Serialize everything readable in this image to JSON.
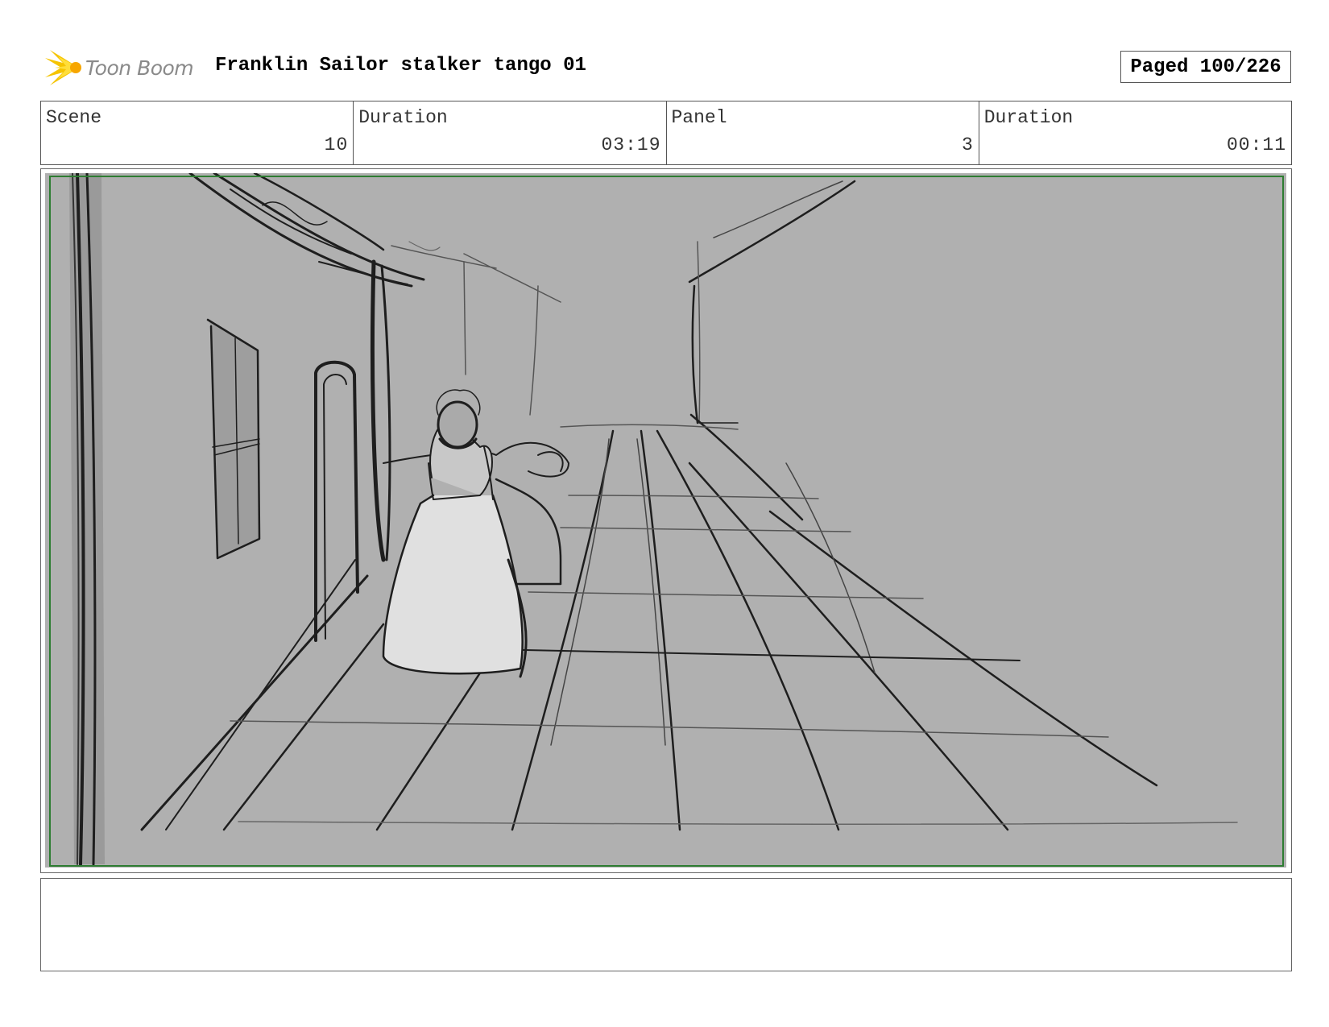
{
  "header": {
    "logo_text": "Toon Boom",
    "title": "Franklin Sailor stalker tango 01",
    "paged": "Paged 100/226"
  },
  "info": {
    "scene_label": "Scene",
    "scene_value": "10",
    "scene_duration_label": "Duration",
    "scene_duration_value": "03:19",
    "panel_label": "Panel",
    "panel_value": "3",
    "panel_duration_label": "Duration",
    "panel_duration_value": "00:11"
  },
  "notes": {
    "text": ""
  },
  "colors": {
    "safe_frame": "#2e7d32",
    "panel_background": "#b0b0b0",
    "logo_burst": "#f5c400"
  }
}
